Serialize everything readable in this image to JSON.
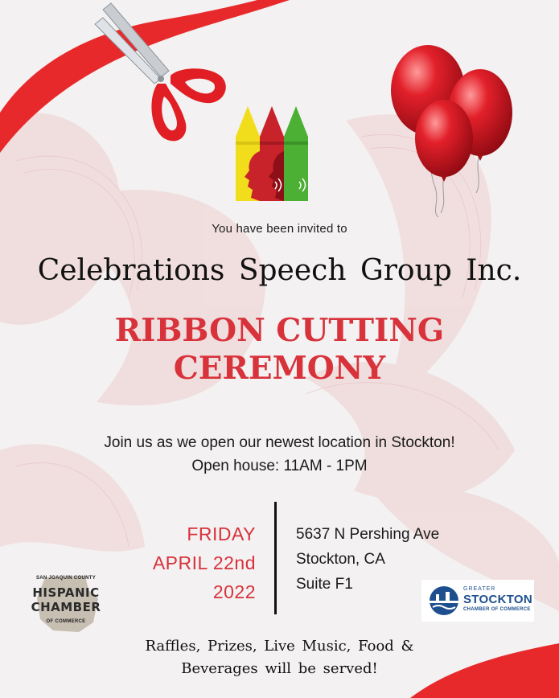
{
  "invitation_line": "You have been invited to",
  "organization": "Celebrations Speech Group Inc.",
  "event_title": [
    "RIBBON CUTTING",
    "CEREMONY"
  ],
  "details": [
    "Join us as we open our newest location in Stockton!",
    "Open house: 11AM - 1PM"
  ],
  "date_lines": [
    "FRIDAY",
    "APRIL 22nd",
    "2022"
  ],
  "address_lines": [
    "5637 N Pershing Ave",
    "Stockton, CA",
    "Suite F1"
  ],
  "footer_lines": [
    "Raffles, Prizes, Live Music, Food &",
    "Beverages will be served!"
  ],
  "hispanic_chamber_logo": {
    "top_text": "SAN JOAQUIN COUNTY",
    "main_lines": [
      "HISPANIC",
      "CHAMBER"
    ],
    "bottom_text": "OF COMMERCE"
  },
  "stockton_chamber_logo": {
    "top_text": "GREATER",
    "main_text": "STOCKTON",
    "bottom_text": "CHAMBER OF COMMERCE"
  },
  "colors": {
    "accent_red": "#d8323b",
    "ribbon_red": "#e8292c",
    "background": "#f3f1f1",
    "crayon_yellow": "#f2dd1c",
    "crayon_red": "#c8222a",
    "crayon_green": "#4bb034",
    "stockton_blue": "#1d4f8f"
  },
  "icons": [
    "scissors-icon",
    "crayons-logo",
    "balloons-icon"
  ]
}
